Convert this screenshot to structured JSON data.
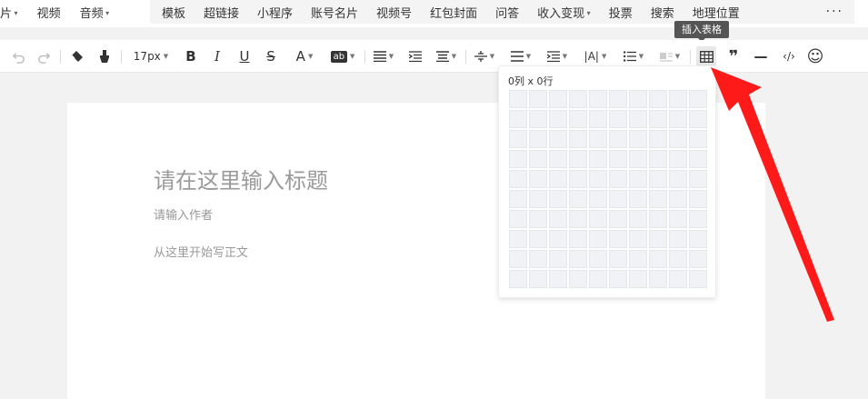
{
  "top_menu_left": {
    "items": [
      {
        "label": "片",
        "dropdown": true
      },
      {
        "label": "视频",
        "dropdown": false
      },
      {
        "label": "音频",
        "dropdown": true
      }
    ]
  },
  "top_menu_right": {
    "items": [
      "模板",
      "超链接",
      "小程序",
      "账号名片",
      "视频号",
      "红包封面",
      "问答",
      "收入变现",
      "投票",
      "搜索",
      "地理位置"
    ],
    "more": "···",
    "dropdown_item": "收入变现"
  },
  "tooltip": {
    "text": "插入表格"
  },
  "toolbar": {
    "font_size": "17px",
    "bold": "B",
    "italic": "I",
    "underline": "U",
    "strike": "S",
    "font_color": "A",
    "bg_color": "ab",
    "letter_spacing": "|A|",
    "quote": "❞",
    "hr": "—",
    "code": "‹/›",
    "emoji": "☺"
  },
  "editor": {
    "title_placeholder": "请在这里输入标题",
    "author_placeholder": "请输入作者",
    "body_placeholder": "从这里开始写正文"
  },
  "table_picker": {
    "label": "0列 x 0行",
    "rows": 10,
    "cols": 10
  }
}
